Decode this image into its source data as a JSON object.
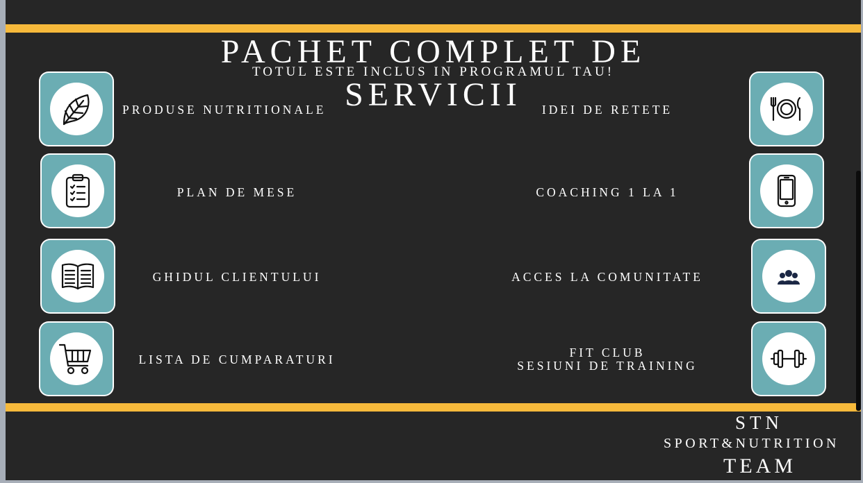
{
  "title": {
    "line1": "PACHET COMPLET DE",
    "line2": "SERVICII"
  },
  "subtitle": "TOTUL ESTE INCLUS IN PROGRAMUL TAU!",
  "services_left": [
    {
      "label": "PRODUSE NUTRITIONALE",
      "icon": "leaf-icon"
    },
    {
      "label": "PLAN DE MESE",
      "icon": "clipboard-checklist-icon"
    },
    {
      "label": "GHIDUL CLIENTULUI",
      "icon": "open-book-icon"
    },
    {
      "label": "LISTA DE CUMPARATURI",
      "icon": "shopping-cart-icon"
    }
  ],
  "services_right": [
    {
      "label": "IDEI DE RETETE",
      "icon": "plate-cutlery-icon"
    },
    {
      "label": "COACHING 1 LA 1",
      "icon": "smartphone-icon"
    },
    {
      "label": "ACCES LA COMUNITATE",
      "icon": "users-group-icon"
    },
    {
      "label_line1": "FIT CLUB",
      "label_line2": "SESIUNI DE TRAINING",
      "icon": "dumbbell-icon"
    }
  ],
  "brand": {
    "line1": "STN",
    "line2": "SPORT&NUTRITION",
    "line3": "TEAM"
  },
  "colors": {
    "background": "#262626",
    "accent": "#f6b93b",
    "tile": "#6badb3",
    "text": "#ffffff"
  }
}
